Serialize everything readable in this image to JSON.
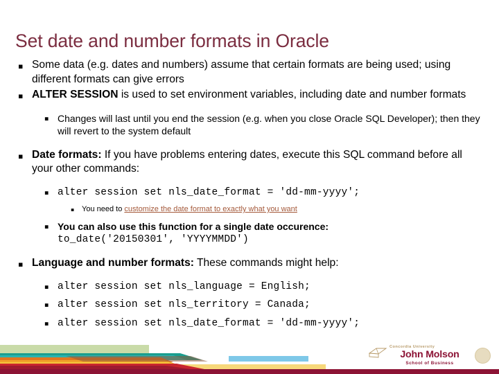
{
  "slide": {
    "title": "Set date and number formats in Oracle",
    "title_color": "#7b2d40",
    "accent_bar_color": "#8c1335",
    "link_color": "#a4593a",
    "bullet_glyph": "▪"
  },
  "content": {
    "b1_text": "Some data (e.g. dates and numbers) assume that certain formats are being used; using different formats can give errors",
    "b2_bold": "ALTER SESSION",
    "b2_rest": " is used to set environment variables, including date and number formats",
    "b3_text": "Changes will last until you end the session (e.g. when you close Oracle SQL Developer); then they will revert to the system default",
    "b4_bold": "Date formats:",
    "b4_rest": " If you have problems entering dates, execute this SQL command before all your other commands:",
    "b5_code": "alter session set nls_date_format = 'dd-mm-yyyy';",
    "b6_prefix": "You need to ",
    "b6_link": "customize the date format to exactly what you want",
    "b7_text": "You can also use this function for a single date occurence:",
    "b7_code": "to_date('20150301', 'YYYYMMDD')",
    "b8_bold": "Language and number formats:",
    "b8_rest": " These commands might help:",
    "b9_code": "alter session set nls_language = English;",
    "b10_code": "alter session set nls_territory = Canada;",
    "b11_code": "alter session set nls_date_format = 'dd-mm-yyyy';"
  },
  "footer": {
    "logo_university": "Concordia University",
    "logo_name": "John Molson",
    "logo_school": "School of Business"
  }
}
